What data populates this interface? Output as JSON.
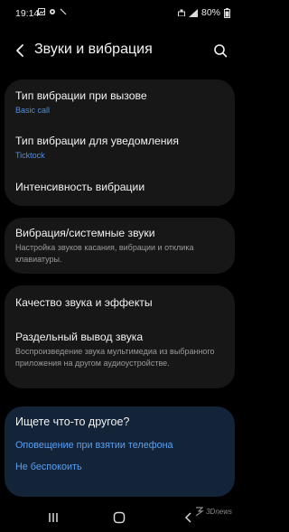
{
  "status_bar": {
    "time": "19:14",
    "battery": "80%"
  },
  "header": {
    "title": "Звуки и вибрация"
  },
  "groups": [
    {
      "items": [
        {
          "title": "Тип вибрации при вызове",
          "value": "Basic call"
        },
        {
          "title": "Тип вибрации для уведомления",
          "value": "Ticktock"
        },
        {
          "title": "Интенсивность вибрации"
        }
      ]
    },
    {
      "items": [
        {
          "title": "Вибрация/системные звуки",
          "description": "Настройка звуков касания, вибрации и отклика клавиатуры."
        }
      ]
    },
    {
      "items": [
        {
          "title": "Качество звука и эффекты"
        },
        {
          "title": "Раздельный вывод звука",
          "description": "Воспроизведение звука мультимедиа из выбранного приложения на другом аудиоустройстве."
        }
      ]
    }
  ],
  "help_card": {
    "title": "Ищете что-то другое?",
    "links": [
      "Оповещение при взятии телефона",
      "Не беспокоить"
    ]
  },
  "watermark": "3Dnews",
  "colors": {
    "background": "#000000",
    "card": "#171717",
    "accent": "#4f8fde",
    "help_card": "#132338"
  }
}
